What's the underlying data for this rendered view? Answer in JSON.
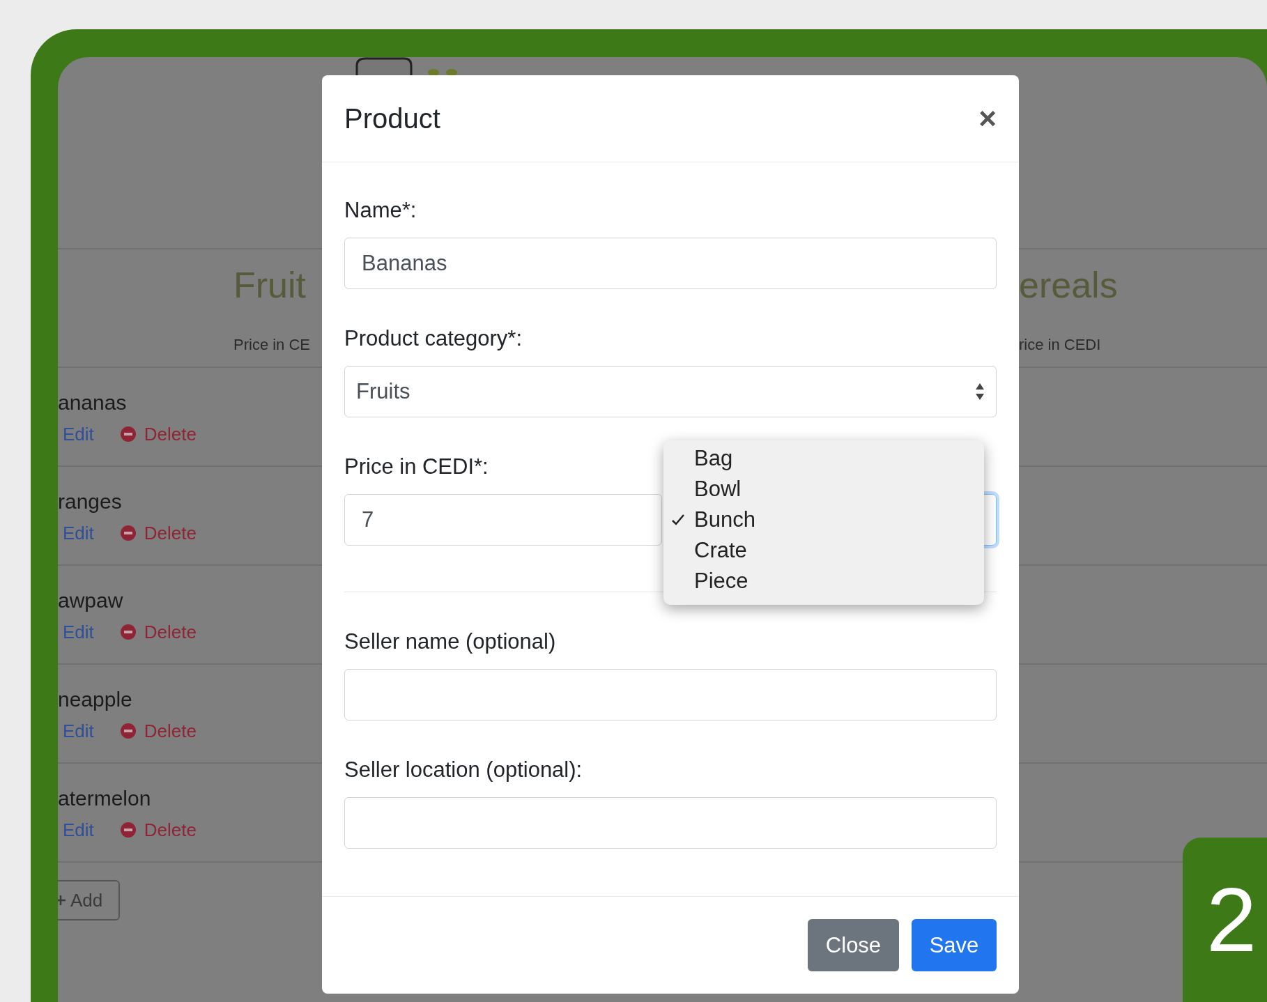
{
  "background": {
    "columns": [
      {
        "heading": "Fruit",
        "subheading": "Price in CE",
        "items": [
          {
            "name": "ananas",
            "edit": "Edit",
            "delete": "Delete"
          },
          {
            "name": "ranges",
            "edit": "Edit",
            "delete": "Delete"
          },
          {
            "name": "awpaw",
            "edit": "Edit",
            "delete": "Delete"
          },
          {
            "name": "neapple",
            "edit": "Edit",
            "delete": "Delete"
          },
          {
            "name": "atermelon",
            "edit": "Edit",
            "delete": "Delete"
          }
        ],
        "add_button": "Add"
      },
      {
        "heading": "ereals",
        "subheading": "rice in CEDI"
      }
    ]
  },
  "modal": {
    "title": "Product",
    "close": "×",
    "sections": [
      [
        {
          "kind": "text",
          "label": "Name*:",
          "value": "Bananas"
        },
        {
          "kind": "select",
          "label": "Product category*:",
          "value": "Fruits"
        },
        {
          "kind": "price",
          "label": "Price in CEDI*:",
          "value": "7",
          "unit_options": [
            {
              "label": "Bag",
              "selected": false
            },
            {
              "label": "Bowl",
              "selected": false
            },
            {
              "label": "Bunch",
              "selected": true
            },
            {
              "label": "Crate",
              "selected": false
            },
            {
              "label": "Piece",
              "selected": false
            }
          ]
        }
      ],
      [
        {
          "kind": "text",
          "label": "Seller name (optional)"
        },
        {
          "kind": "text",
          "label": "Seller location (optional):"
        }
      ]
    ],
    "buttons": [
      {
        "label": "Close",
        "kind": "secondary"
      },
      {
        "label": "Save",
        "kind": "primary"
      }
    ]
  },
  "badge": "2"
}
